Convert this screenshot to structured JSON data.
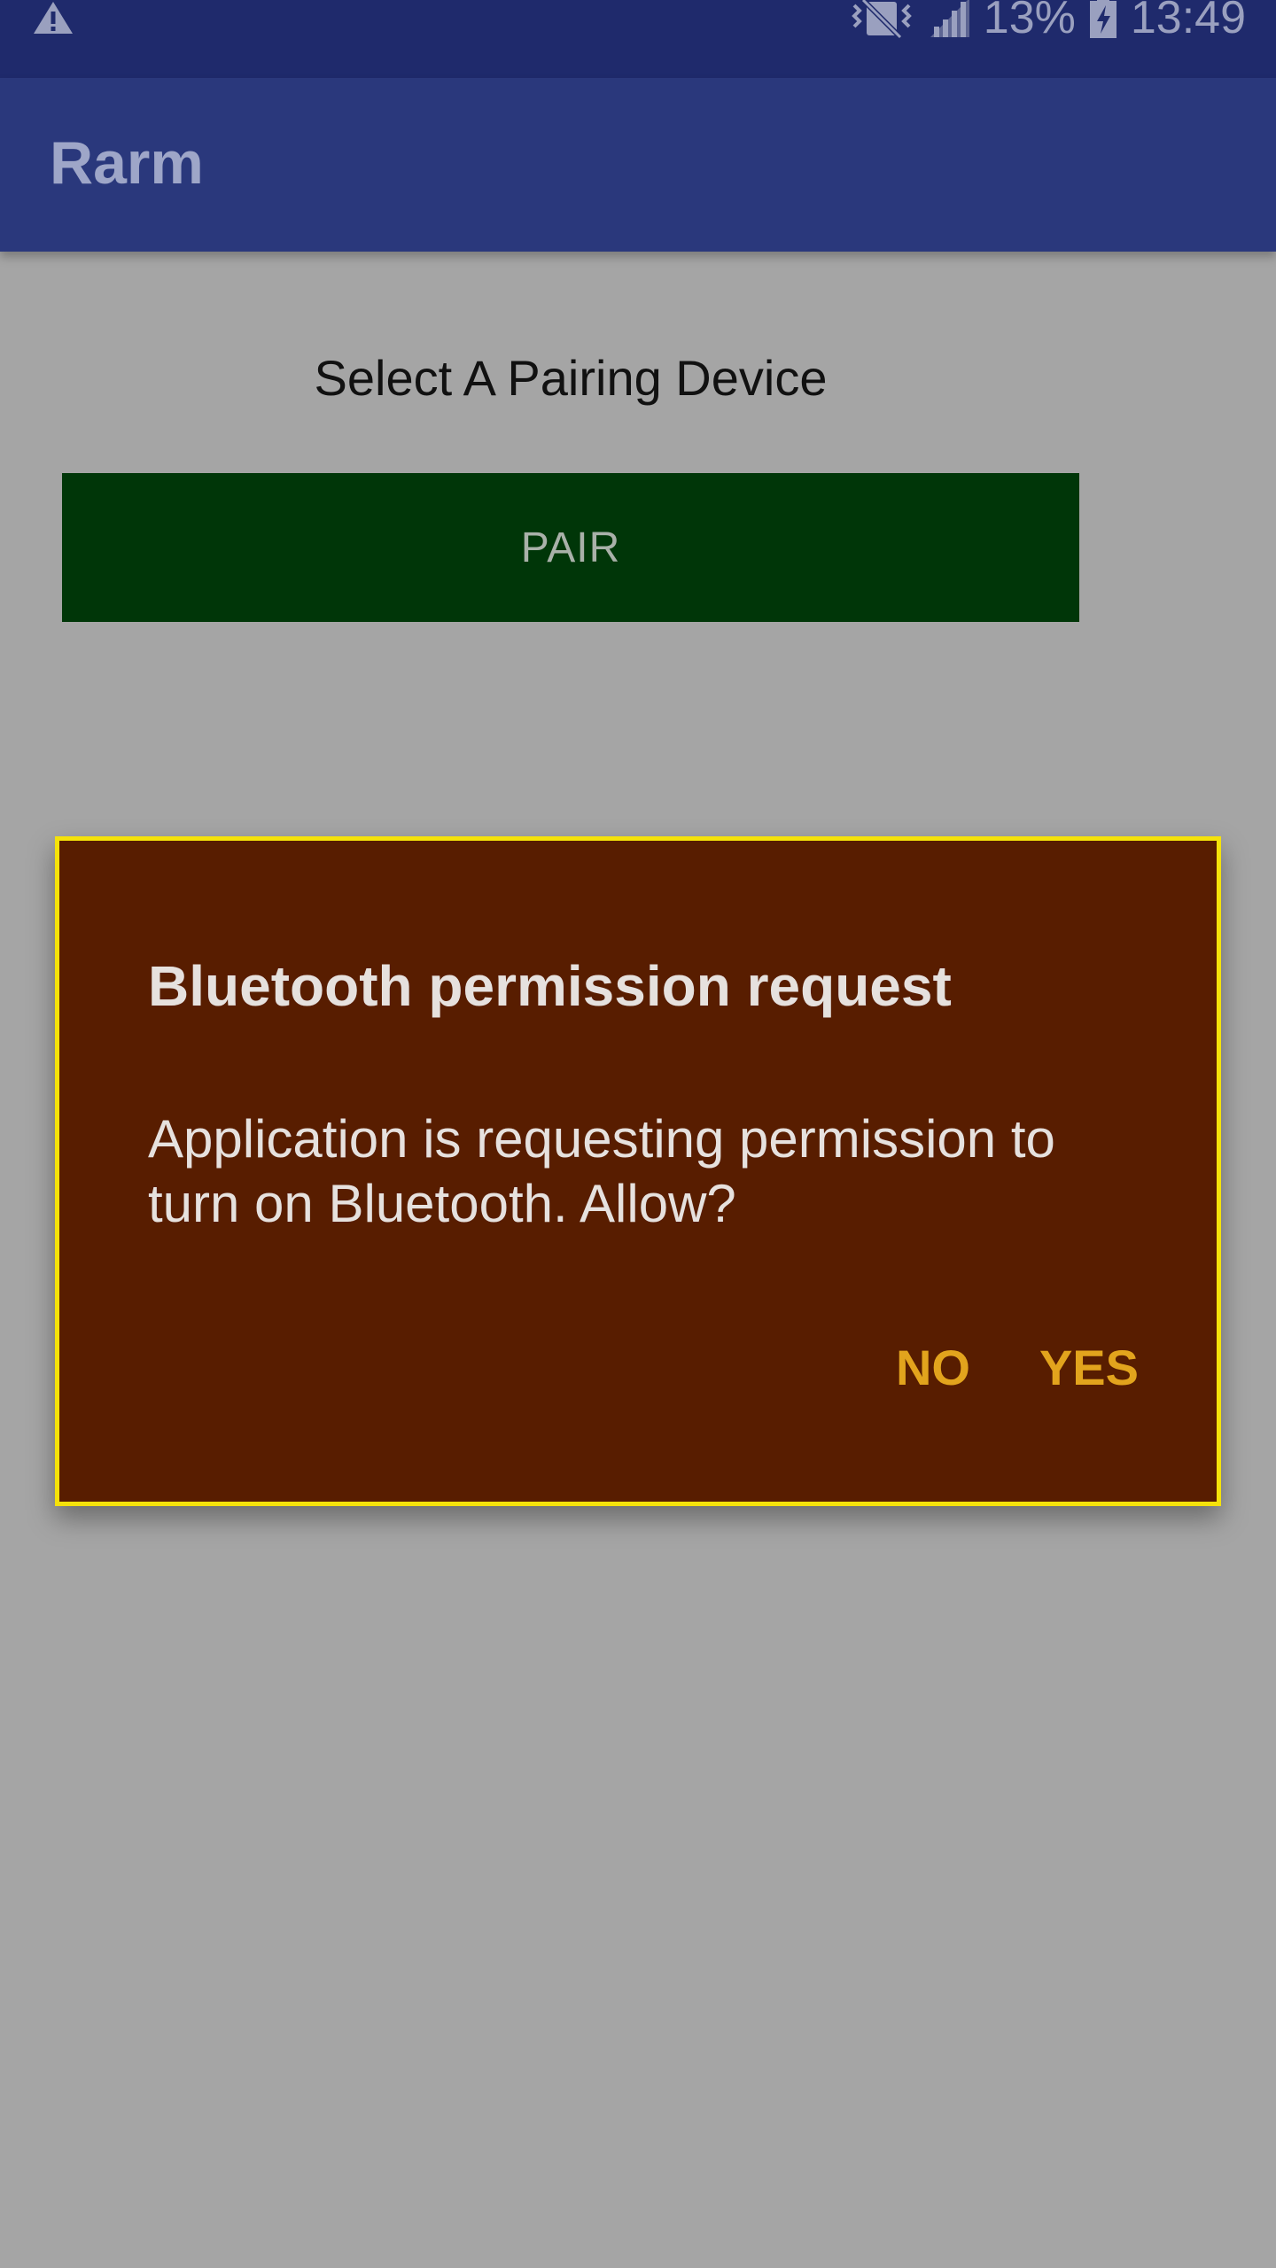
{
  "status_bar": {
    "battery_percent": "13%",
    "time": "13:49",
    "icons": [
      "warning-icon",
      "vibrate-icon",
      "signal-icon",
      "battery-icon"
    ],
    "background_color": "#1f2a6c"
  },
  "app_bar": {
    "title": "Rarm",
    "background_color": "#2a387c"
  },
  "main": {
    "select_label": "Select A Pairing Device",
    "pair_button_label": "PAIR",
    "pair_button_color": "#003608"
  },
  "dialog": {
    "title": "Bluetooth permission request",
    "message": "Application is requesting permission to turn on Bluetooth. Allow?",
    "no_label": "NO",
    "yes_label": "YES",
    "background_color": "#581d00",
    "border_color": "#f5e20a",
    "action_color": "#e2a41d"
  }
}
